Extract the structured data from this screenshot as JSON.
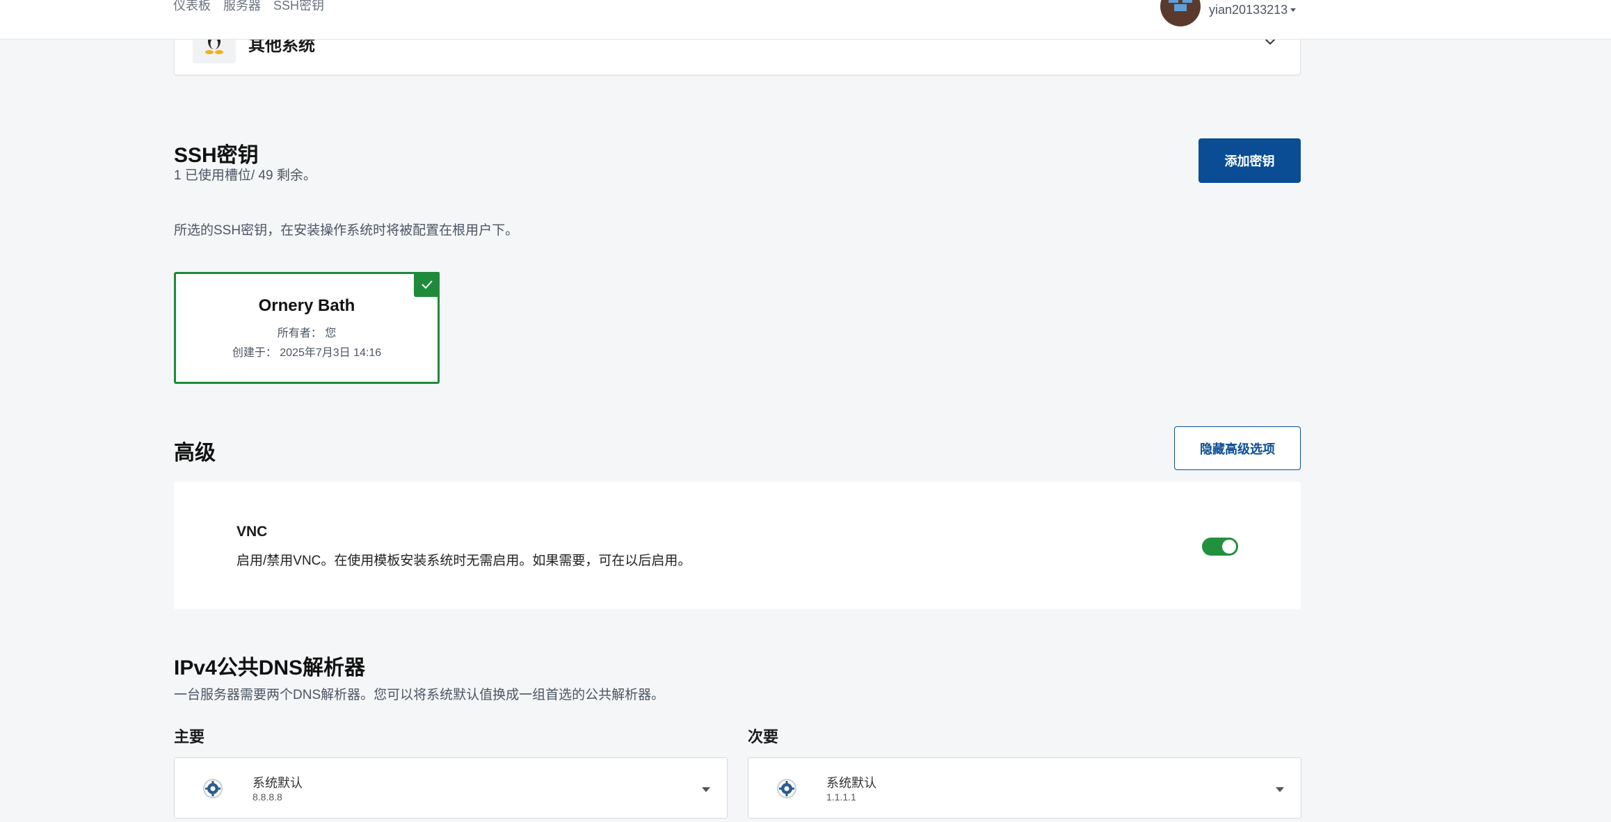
{
  "header": {
    "breadcrumbs": [
      "仪表板",
      "服务器",
      "SSH密钥"
    ],
    "username": "yian20133213"
  },
  "os": {
    "label": "其他系统"
  },
  "ssh": {
    "title": "SSH密钥",
    "slots": "1 已使用槽位/ 49 剩余。",
    "add_button": "添加密钥",
    "note": "所选的SSH密钥，在安装操作系统时将被配置在根用户下。",
    "key": {
      "name": "Ornery Bath",
      "owner_line": "所有者： 您",
      "created_line": "创建于： 2025年7月3日 14:16",
      "selected": true
    }
  },
  "advanced": {
    "title": "高级",
    "hide_button": "隐藏高级选项",
    "vnc": {
      "title": "VNC",
      "description": "启用/禁用VNC。在使用模板安装系统时无需启用。如果需要，可在以后启用。",
      "enabled": true
    }
  },
  "dns": {
    "title": "IPv4公共DNS解析器",
    "description": "一台服务器需要两个DNS解析器。您可以将系统默认值换成一组首选的公共解析器。",
    "primary": {
      "label": "主要",
      "value": "系统默认",
      "ip": "8.8.8.8"
    },
    "secondary": {
      "label": "次要",
      "value": "系统默认",
      "ip": "1.1.1.1"
    }
  },
  "colors": {
    "primary": "#0a4d94",
    "success": "#1e8a3a",
    "background": "#f5f6f8"
  }
}
